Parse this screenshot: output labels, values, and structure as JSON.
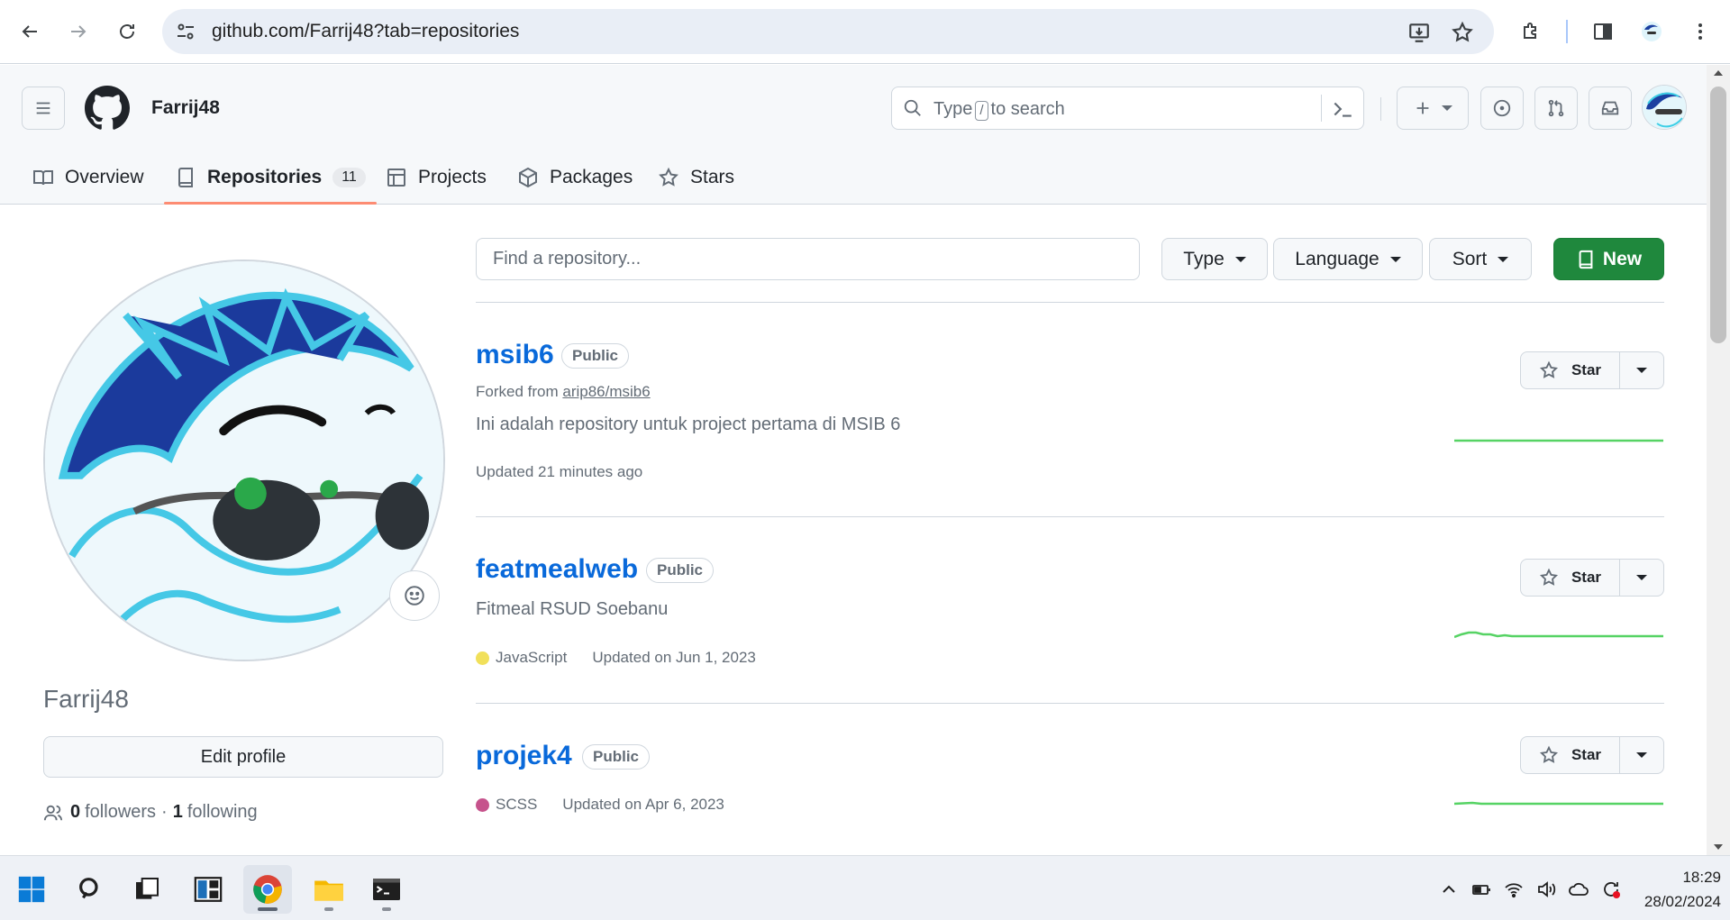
{
  "browser": {
    "url": "github.com/Farrij48?tab=repositories"
  },
  "header": {
    "username": "Farrij48",
    "search_placeholder_before": "Type",
    "search_key": "/",
    "search_placeholder_after": "to search"
  },
  "tabs": [
    {
      "label": "Overview"
    },
    {
      "label": "Repositories",
      "count": "11"
    },
    {
      "label": "Projects"
    },
    {
      "label": "Packages"
    },
    {
      "label": "Stars"
    }
  ],
  "profile": {
    "nickname": "Farrij48",
    "edit_label": "Edit profile",
    "followers_count": "0",
    "followers_label": "followers",
    "separator": "·",
    "following_count": "1",
    "following_label": "following"
  },
  "filters": {
    "find_placeholder": "Find a repository...",
    "type_label": "Type",
    "language_label": "Language",
    "sort_label": "Sort",
    "new_label": "New"
  },
  "repos": [
    {
      "name": "msib6",
      "visibility": "Public",
      "fork_prefix": "Forked from",
      "fork_source": "arip86/msib6",
      "description": "Ini adalah repository untuk project pertama di MSIB 6",
      "language": "",
      "updated": "Updated 21 minutes ago",
      "star_label": "Star"
    },
    {
      "name": "featmealweb",
      "visibility": "Public",
      "description": "Fitmeal RSUD Soebanu",
      "language": "JavaScript",
      "language_color": "#f1e05a",
      "updated": "Updated on Jun 1, 2023",
      "star_label": "Star"
    },
    {
      "name": "projek4",
      "visibility": "Public",
      "language": "SCSS",
      "language_color": "#c6538c",
      "updated": "Updated on Apr 6, 2023",
      "star_label": "Star"
    }
  ],
  "taskbar": {
    "time": "18:29",
    "date": "28/02/2024"
  },
  "colors": {
    "accent_green": "#1f883d",
    "link_blue": "#0969da",
    "tab_underline": "#fd8c73",
    "sparkline": "#56d364"
  }
}
